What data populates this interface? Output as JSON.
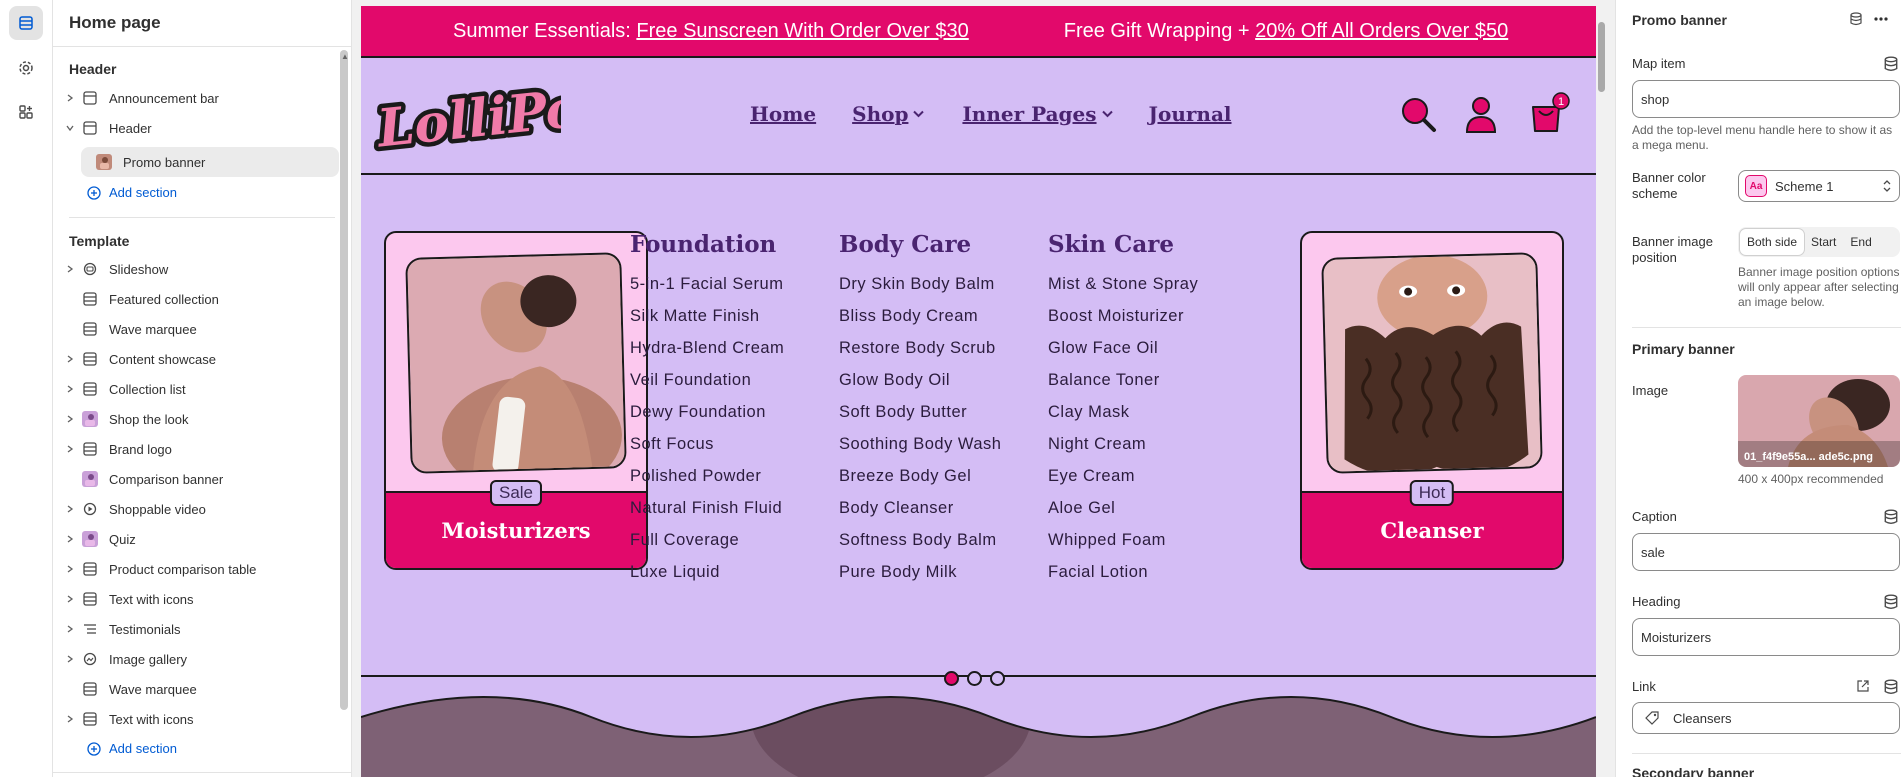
{
  "editor": {
    "page_title": "Home page",
    "header_group": "Header",
    "header_items": [
      {
        "label": "Announcement bar",
        "icon": "section-icon"
      },
      {
        "label": "Header",
        "icon": "section-icon"
      }
    ],
    "header_child": {
      "label": "Promo banner",
      "icon": "image-thumb-icon"
    },
    "add_section_label": "Add section",
    "template_group": "Template",
    "template_items": [
      {
        "label": "Slideshow",
        "icon": "slideshow-icon",
        "expandable": true
      },
      {
        "label": "Featured collection",
        "icon": "section-icon",
        "expandable": false
      },
      {
        "label": "Wave marquee",
        "icon": "section-icon",
        "expandable": false
      },
      {
        "label": "Content showcase",
        "icon": "section-icon",
        "expandable": true
      },
      {
        "label": "Collection list",
        "icon": "section-icon",
        "expandable": true
      },
      {
        "label": "Shop the look",
        "icon": "image-thumb-icon",
        "expandable": true
      },
      {
        "label": "Brand logo",
        "icon": "section-icon",
        "expandable": true
      },
      {
        "label": "Comparison banner",
        "icon": "image-thumb-icon",
        "expandable": false
      },
      {
        "label": "Shoppable video",
        "icon": "play-icon",
        "expandable": true
      },
      {
        "label": "Quiz",
        "icon": "image-thumb-icon",
        "expandable": true
      },
      {
        "label": "Product comparison table",
        "icon": "section-icon",
        "expandable": true
      },
      {
        "label": "Text with icons",
        "icon": "section-icon",
        "expandable": true
      },
      {
        "label": "Testimonials",
        "icon": "list-icon",
        "expandable": true
      },
      {
        "label": "Image gallery",
        "icon": "gallery-icon",
        "expandable": true
      },
      {
        "label": "Wave marquee",
        "icon": "section-icon",
        "expandable": false
      },
      {
        "label": "Text with icons",
        "icon": "section-icon",
        "expandable": true
      }
    ]
  },
  "store": {
    "announcement": [
      {
        "prefix": "Summer Essentials: ",
        "link": "Free Sunscreen With Order Over $30"
      },
      {
        "prefix": "Free Gift Wrapping + ",
        "link": "20% Off All Orders Over $50"
      }
    ],
    "logo_text": "LolliPop",
    "nav": [
      {
        "label": "Home",
        "dropdown": false
      },
      {
        "label": "Shop",
        "dropdown": true
      },
      {
        "label": "Inner Pages",
        "dropdown": true
      },
      {
        "label": "Journal",
        "dropdown": false
      }
    ],
    "cart_count": "1",
    "mega_menu": {
      "left_card": {
        "badge": "Sale",
        "title": "Moisturizers"
      },
      "right_card": {
        "badge": "Hot",
        "title": "Cleanser"
      },
      "columns": [
        {
          "title": "Foundation",
          "links": [
            "5-in-1 Facial Serum",
            "Silk Matte Finish",
            "Hydra-Blend Cream",
            "Veil Foundation",
            "Dewy Foundation",
            "Soft Focus",
            "Polished Powder",
            "Natural Finish Fluid",
            "Full Coverage",
            "Luxe Liquid"
          ]
        },
        {
          "title": "Body Care",
          "links": [
            "Dry Skin Body Balm",
            "Bliss Body Cream",
            "Restore Body Scrub",
            "Glow Body Oil",
            "Soft Body Butter",
            "Soothing Body Wash",
            "Breeze Body Gel",
            "Body Cleanser",
            "Softness Body Balm",
            "Pure Body Milk"
          ]
        },
        {
          "title": "Skin Care",
          "links": [
            "Mist & Stone Spray",
            "Boost Moisturizer",
            "Glow Face Oil",
            "Balance Toner",
            "Clay Mask",
            "Night Cream",
            "Eye Cream",
            "Aloe Gel",
            "Whipped Foam",
            "Facial Lotion"
          ]
        }
      ]
    }
  },
  "settings": {
    "title": "Promo banner",
    "map_item_label": "Map item",
    "map_item_value": "shop",
    "map_item_help": "Add the top-level menu handle here to show it as a mega menu.",
    "color_scheme_label": "Banner color scheme",
    "color_scheme_value": "Scheme 1",
    "swatch_text": "Aa",
    "image_position_label": "Banner image position",
    "image_position_options": [
      "Both side",
      "Start",
      "End"
    ],
    "image_position_help": "Banner image position options will only appear after selecting an image below.",
    "primary_heading": "Primary banner",
    "image_label": "Image",
    "image_filename": "01_f4f9e55a... ade5c.png",
    "image_help": "400 x 400px recommended",
    "caption_label": "Caption",
    "caption_value": "sale",
    "heading_label": "Heading",
    "heading_value": "Moisturizers",
    "link_label": "Link",
    "link_value": "Cleansers",
    "secondary_heading": "Secondary banner"
  },
  "colors": {
    "brand_pink": "#e2096b",
    "lavender": "#d4bdf5",
    "card_pink": "#fcc8ee",
    "editor_link": "#005bd3"
  }
}
